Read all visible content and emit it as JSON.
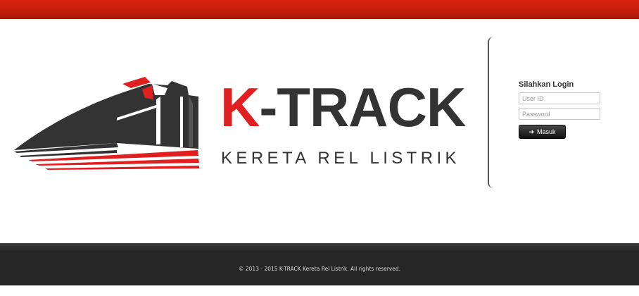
{
  "brand": {
    "title_k": "K",
    "title_rest": "-TRACK",
    "subtitle": "KERETA REL LISTRIK"
  },
  "login": {
    "heading": "Silahkan Login",
    "user_placeholder": "User ID",
    "password_placeholder": "Password",
    "submit_label": "Masuk",
    "submit_icon": "arrow-right-icon"
  },
  "footer": {
    "copyright": "© 2013 - 2015 K-TRACK Kereta Rel Listrik. All rights reserved."
  },
  "colors": {
    "header_red": "#d9230f",
    "brand_red": "#e02020",
    "brand_dark": "#333333",
    "footer_bg": "#262626"
  }
}
